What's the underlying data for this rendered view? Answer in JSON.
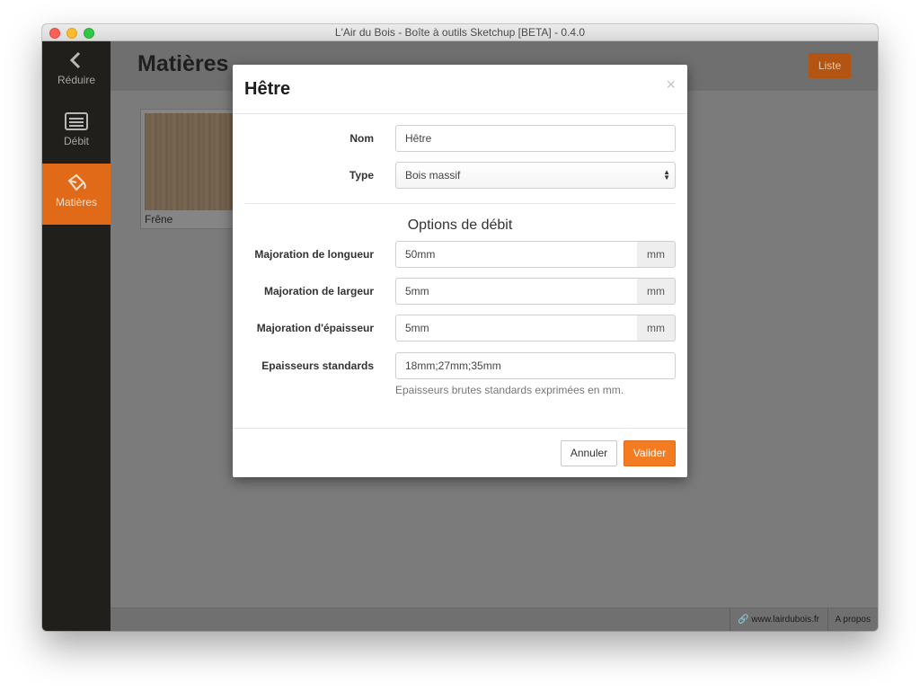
{
  "window": {
    "title": "L'Air du Bois - Boîte à outils Sketchup [BETA] - 0.4.0"
  },
  "sidebar": {
    "items": [
      {
        "label": "Réduire",
        "icon": "chevron-left-icon"
      },
      {
        "label": "Débit",
        "icon": "list-icon"
      },
      {
        "label": "Matières",
        "icon": "paint-bucket-icon",
        "active": true
      }
    ]
  },
  "main": {
    "title": "Matières",
    "liste_button": "Liste",
    "materials": [
      {
        "name": "Frêne"
      }
    ]
  },
  "footer": {
    "site_link": "www.lairdubois.fr",
    "about_link": "A propos"
  },
  "modal": {
    "title": "Hêtre",
    "close_glyph": "×",
    "nom": {
      "label": "Nom",
      "value": "Hêtre"
    },
    "type": {
      "label": "Type",
      "value": "Bois massif"
    },
    "section_title": "Options de débit",
    "longueur": {
      "label": "Majoration de longueur",
      "value": "50mm",
      "unit": "mm"
    },
    "largeur": {
      "label": "Majoration de largeur",
      "value": "5mm",
      "unit": "mm"
    },
    "epaisseur": {
      "label": "Majoration d'épaisseur",
      "value": "5mm",
      "unit": "mm"
    },
    "standards": {
      "label": "Epaisseurs standards",
      "value": "18mm;27mm;35mm",
      "help": "Epaisseurs brutes standards exprimées en mm."
    },
    "cancel_label": "Annuler",
    "ok_label": "Valider"
  },
  "colors": {
    "accent": "#f37b22",
    "sidebar_bg": "#201f1b",
    "sidebar_active": "#e06a18"
  }
}
